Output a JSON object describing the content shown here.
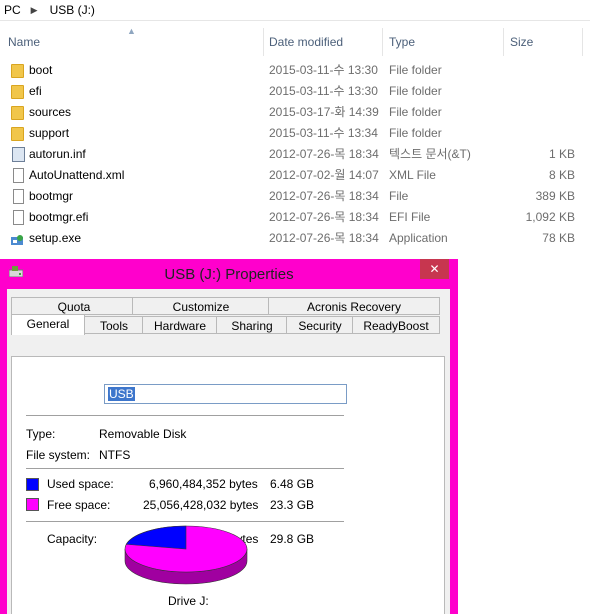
{
  "explorer": {
    "breadcrumb": [
      "PC",
      "USB (J:)"
    ],
    "columns": {
      "name": "Name",
      "date": "Date modified",
      "type": "Type",
      "size": "Size"
    },
    "rows": [
      {
        "name": "boot",
        "date": "2015-03-11-수 13:30",
        "type": "File folder",
        "size": "",
        "icon": "folder-icon"
      },
      {
        "name": "efi",
        "date": "2015-03-11-수 13:30",
        "type": "File folder",
        "size": "",
        "icon": "folder-icon"
      },
      {
        "name": "sources",
        "date": "2015-03-17-화 14:39",
        "type": "File folder",
        "size": "",
        "icon": "folder-icon"
      },
      {
        "name": "support",
        "date": "2015-03-11-수 13:34",
        "type": "File folder",
        "size": "",
        "icon": "folder-icon"
      },
      {
        "name": "autorun.inf",
        "date": "2012-07-26-목 18:34",
        "type": "텍스트 문서(&T)",
        "size": "1 KB",
        "icon": "inf-file-icon"
      },
      {
        "name": "AutoUnattend.xml",
        "date": "2012-07-02-월 14:07",
        "type": "XML File",
        "size": "8 KB",
        "icon": "file-icon"
      },
      {
        "name": "bootmgr",
        "date": "2012-07-26-목 18:34",
        "type": "File",
        "size": "389 KB",
        "icon": "file-icon"
      },
      {
        "name": "bootmgr.efi",
        "date": "2012-07-26-목 18:34",
        "type": "EFI File",
        "size": "1,092 KB",
        "icon": "file-icon"
      },
      {
        "name": "setup.exe",
        "date": "2012-07-26-목 18:34",
        "type": "Application",
        "size": "78 KB",
        "icon": "setup-exe-icon"
      }
    ]
  },
  "dialog": {
    "title": "USB (J:) Properties",
    "close_label": "✕",
    "tabs_row1": [
      "Quota",
      "Customize",
      "Acronis Recovery"
    ],
    "tabs_row2": [
      "General",
      "Tools",
      "Hardware",
      "Sharing",
      "Security",
      "ReadyBoost"
    ],
    "active_tab": "General",
    "volume_name": "USB",
    "type_label": "Type:",
    "type_value": "Removable Disk",
    "fs_label": "File system:",
    "fs_value": "NTFS",
    "used_label": "Used space:",
    "used_bytes": "6,960,484,352 bytes",
    "used_human": "6.48 GB",
    "free_label": "Free space:",
    "free_bytes": "25,056,428,032 bytes",
    "free_human": "23.3 GB",
    "capacity_label": "Capacity:",
    "capacity_bytes": "32,016,912,384 bytes",
    "capacity_human": "29.8 GB",
    "drive_label": "Drive J:",
    "used_fraction": 0.2174,
    "colors": {
      "used": "#0000ff",
      "free": "#ff00ff",
      "frame": "#ff00cc",
      "close": "#c7364f"
    }
  }
}
